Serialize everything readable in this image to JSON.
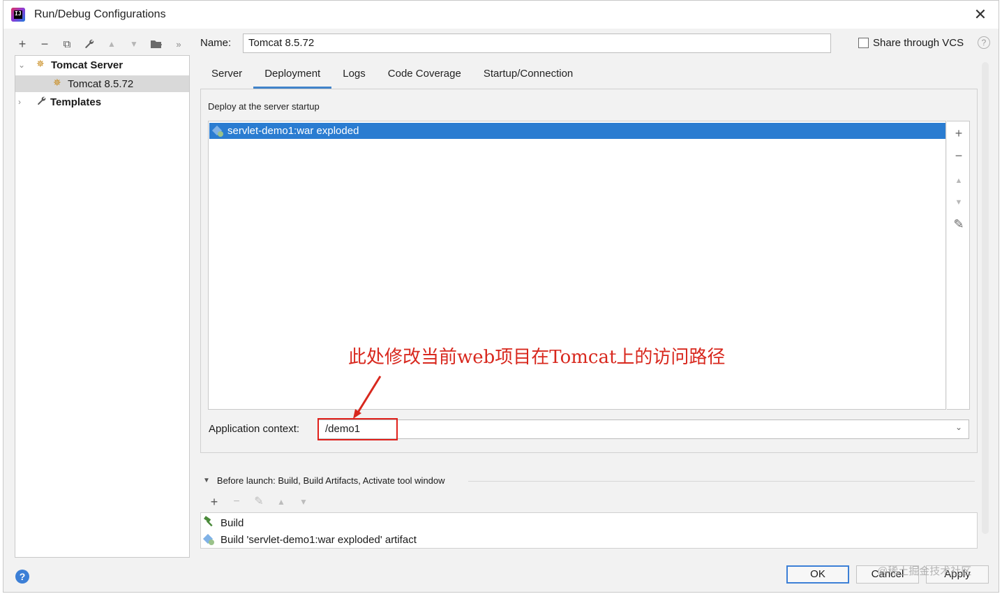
{
  "window": {
    "title": "Run/Debug Configurations",
    "app_icon_text": "IJ"
  },
  "toolbar": {
    "add": "+",
    "remove": "−",
    "copy": "⧉",
    "edit": "🔧",
    "up": "▲",
    "down": "▼",
    "folder": "📁",
    "more": "»"
  },
  "tree": {
    "items": [
      {
        "label": "Tomcat Server",
        "bold": true,
        "expanded": true
      },
      {
        "label": "Tomcat 8.5.72",
        "bold": false,
        "selected": true
      },
      {
        "label": "Templates",
        "bold": true,
        "expanded": false
      }
    ]
  },
  "name_row": {
    "label": "Name:",
    "value": "Tomcat 8.5.72",
    "share_label": "Share through VCS",
    "help": "?"
  },
  "tabs": [
    {
      "label": "Server",
      "active": false
    },
    {
      "label": "Deployment",
      "active": true
    },
    {
      "label": "Logs",
      "active": false
    },
    {
      "label": "Code Coverage",
      "active": false
    },
    {
      "label": "Startup/Connection",
      "active": false
    }
  ],
  "deployment": {
    "heading": "Deploy at the server startup",
    "items": [
      "servlet-demo1:war exploded"
    ],
    "side_tools": {
      "add": "+",
      "remove": "−",
      "up": "▲",
      "down": "▼",
      "edit": "✎"
    }
  },
  "annotation": {
    "text": "此处修改当前web项目在Tomcat上的访问路径",
    "color": "#d8281e"
  },
  "app_context": {
    "label": "Application context:",
    "value": "/demo1",
    "dropdown": "⌄"
  },
  "before_launch": {
    "title": "Before launch: Build, Build Artifacts, Activate tool window",
    "tools": {
      "add": "+",
      "remove": "−",
      "edit": "✎",
      "up": "▲",
      "down": "▼"
    },
    "items": [
      "Build",
      "Build 'servlet-demo1:war exploded' artifact"
    ]
  },
  "footer": {
    "help": "?",
    "ok": "OK",
    "cancel": "Cancel",
    "apply": "Apply",
    "watermark": "@稀土掘金技术社区"
  },
  "colors": {
    "accent": "#4083c9",
    "selection": "#2a7cd1",
    "annotation_red": "#e0201b"
  }
}
